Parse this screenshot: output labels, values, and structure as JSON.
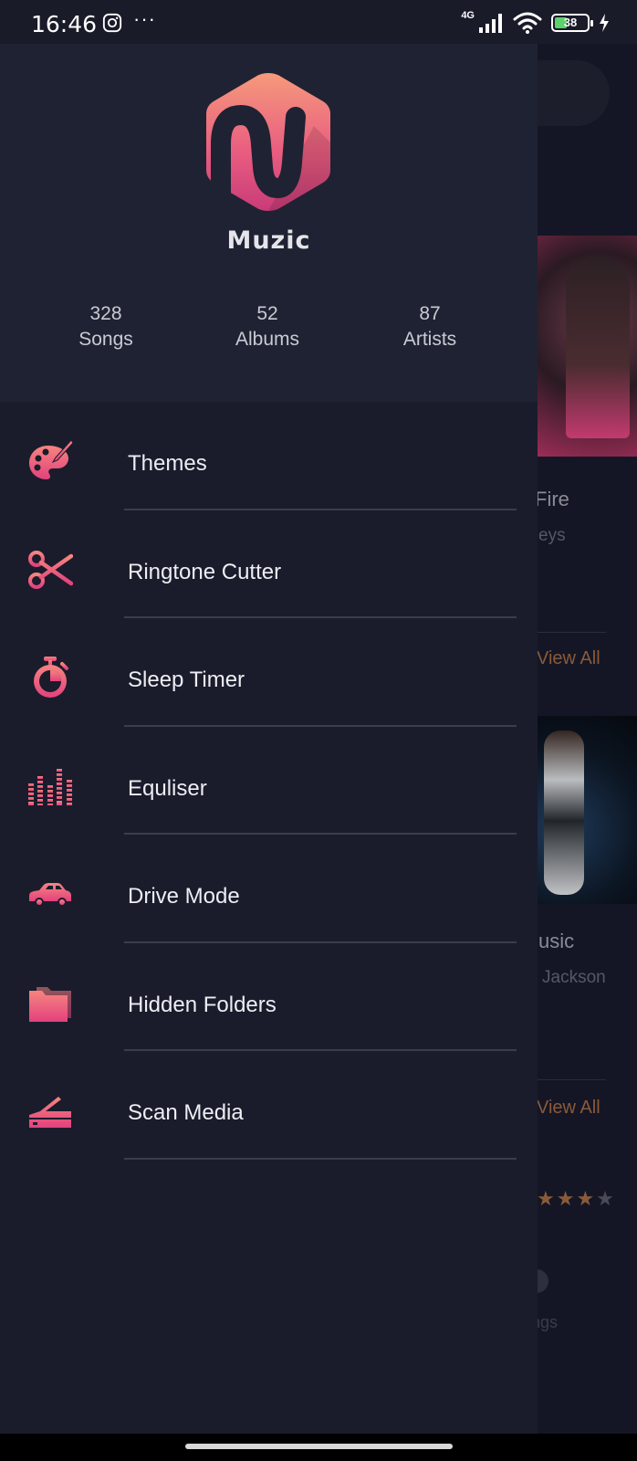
{
  "status_bar": {
    "time": "16:46",
    "more_indicator": "···",
    "network_type": "4G",
    "battery_level": "38",
    "battery_fraction": 0.38,
    "icons": [
      "instagram-icon",
      "signal-icon",
      "wifi-icon",
      "battery-icon",
      "charging-icon"
    ]
  },
  "drawer": {
    "app_name": "Muzic",
    "stats": [
      {
        "count": "328",
        "label": "Songs"
      },
      {
        "count": "52",
        "label": "Albums"
      },
      {
        "count": "87",
        "label": "Artists"
      }
    ],
    "menu_items": [
      {
        "label": "Themes",
        "icon": "palette-icon"
      },
      {
        "label": "Ringtone Cutter",
        "icon": "scissors-icon"
      },
      {
        "label": "Sleep Timer",
        "icon": "stopwatch-icon"
      },
      {
        "label": "Equliser",
        "icon": "equalizer-icon"
      },
      {
        "label": "Drive Mode",
        "icon": "car-icon"
      },
      {
        "label": "Hidden Folders",
        "icon": "folders-icon"
      },
      {
        "label": "Scan Media",
        "icon": "scanner-icon"
      }
    ]
  },
  "background": {
    "card1_title": "Fire",
    "card1_artist": "eys",
    "view_all_1": "View All",
    "card2_title": "usic",
    "card2_artist": "Jackson",
    "view_all_2": "View All",
    "rating": "★★★",
    "rating_dim": "★",
    "bottom_label": "ngs"
  },
  "colors": {
    "accent_start": "#f47c8a",
    "accent_end": "#e0417a",
    "drawer_bg": "#1a1c2c",
    "header_bg": "#1f2233"
  }
}
